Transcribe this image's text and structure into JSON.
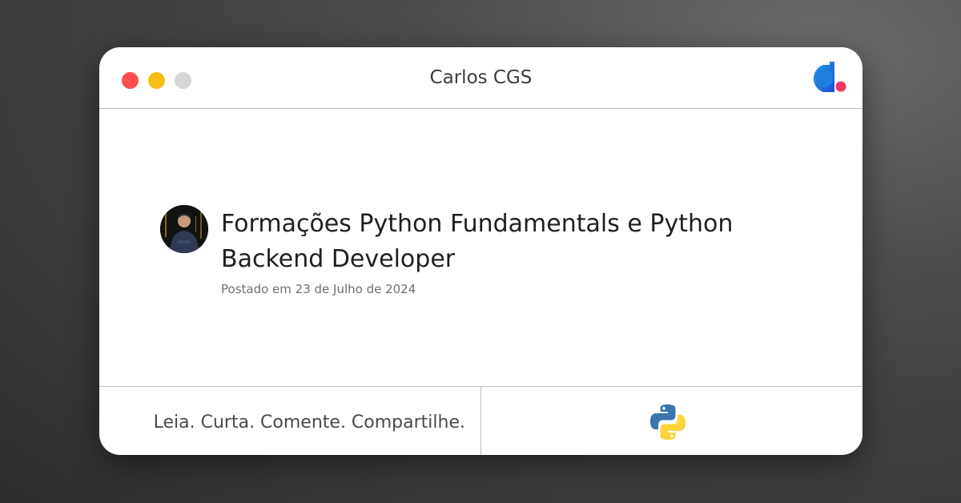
{
  "window": {
    "title": "Carlos CGS",
    "controls": [
      {
        "name": "close",
        "color": "#ff4e4e"
      },
      {
        "name": "minimize",
        "color": "#f7bd17"
      },
      {
        "name": "maximize",
        "color": "#d6d6d6"
      }
    ],
    "brand_icon": "dio-logo-icon"
  },
  "post": {
    "author_avatar": "author-avatar",
    "title": "Formações Python Fundamentals e Python Backend Developer",
    "date": "Postado em 23 de Julho de 2024"
  },
  "footer": {
    "tagline": "Leia. Curta. Comente. Compartilhe.",
    "tech_icon": "python-logo-icon"
  },
  "colors": {
    "background": "#3a3838",
    "card": "#ffffff",
    "divider": "#bdbdbd",
    "title_text": "#1f1f1f",
    "muted_text": "#6f6f6f",
    "brand_blue": "#1e6fd9",
    "brand_pink": "#f0355f",
    "python_blue": "#3a75b0",
    "python_yellow": "#ffd43b"
  }
}
